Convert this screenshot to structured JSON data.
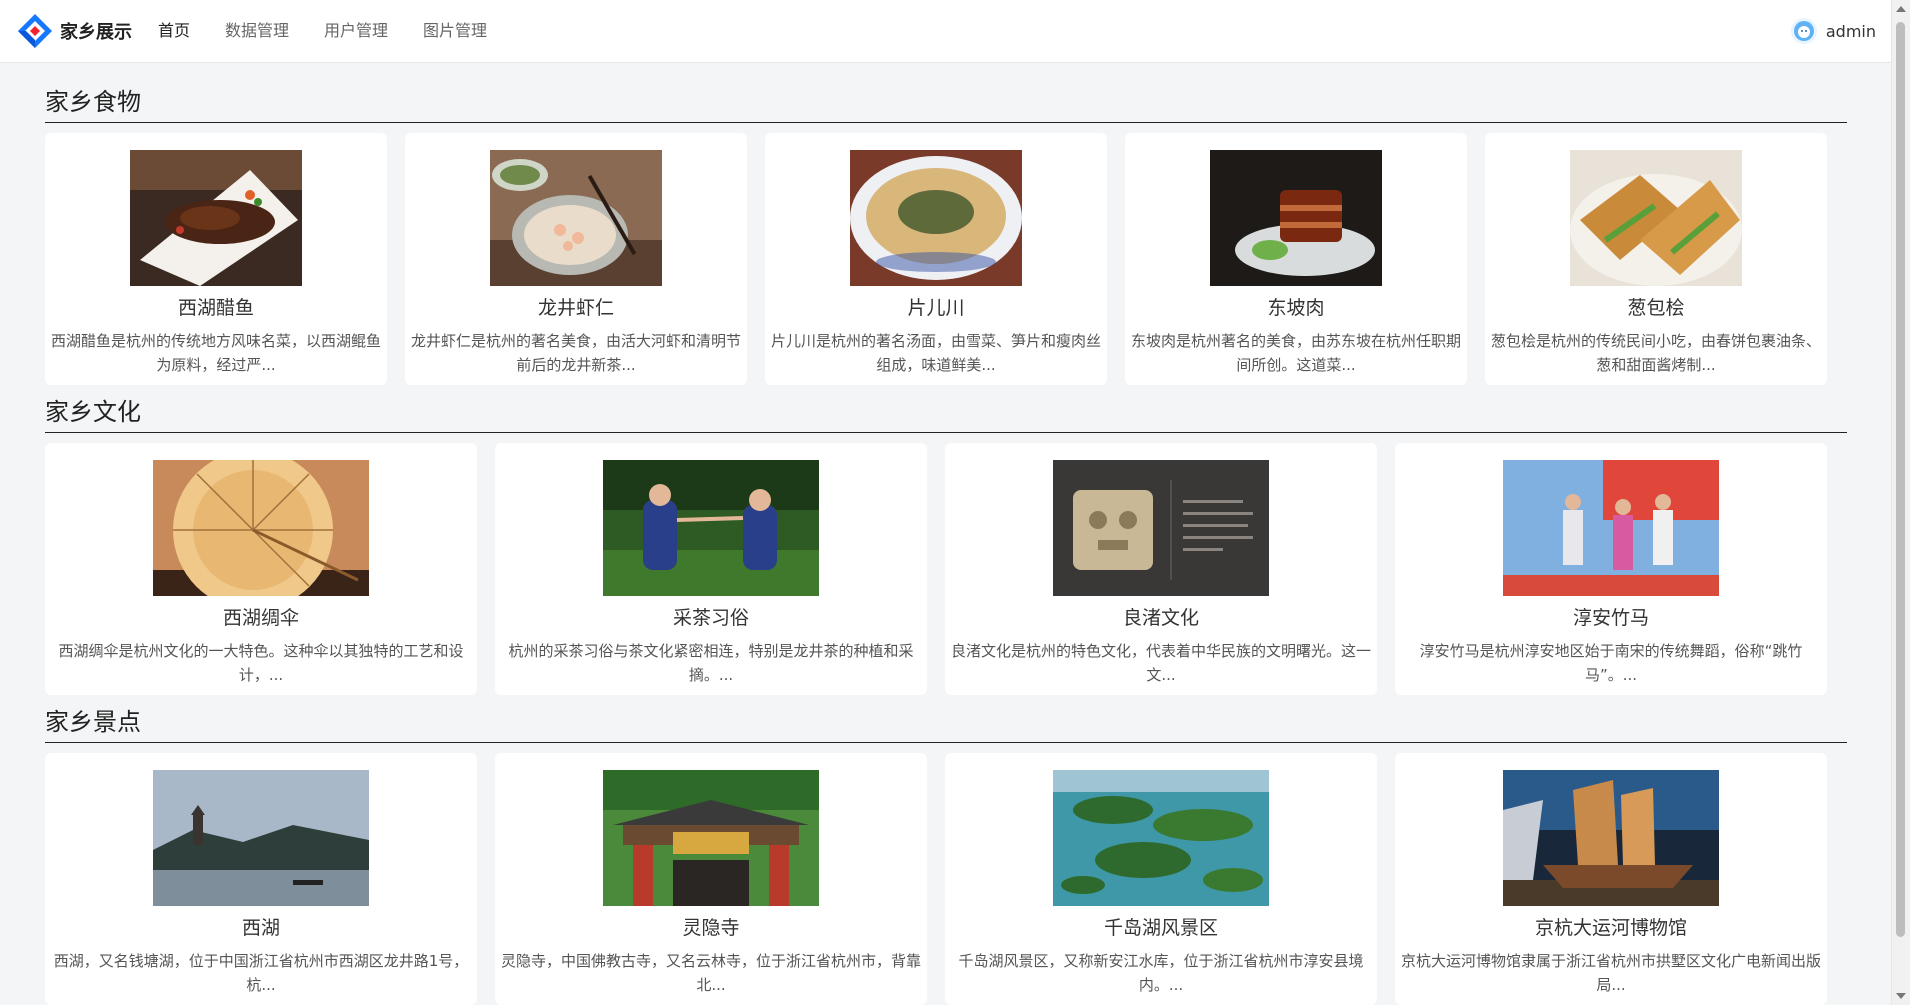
{
  "header": {
    "logo_text": "家乡展示",
    "nav": [
      "首页",
      "数据管理",
      "用户管理",
      "图片管理"
    ],
    "active_nav": "首页",
    "username": "admin"
  },
  "sections": [
    {
      "title": "家乡食物",
      "items": [
        {
          "name": "西湖醋鱼",
          "desc": "西湖醋鱼是杭州的传统地方风味名菜，以西湖鲲鱼为原料，经过严..."
        },
        {
          "name": "龙井虾仁",
          "desc": "龙井虾仁是杭州的著名美食，由活大河虾和清明节前后的龙井新茶..."
        },
        {
          "name": "片儿川",
          "desc": "片儿川是杭州的著名汤面，由雪菜、笋片和瘦肉丝组成，味道鲜美..."
        },
        {
          "name": "东坡肉",
          "desc": "东坡肉是杭州著名的美食，由苏东坡在杭州任职期间所创。这道菜..."
        },
        {
          "name": "葱包桧",
          "desc": "葱包桧是杭州的传统民间小吃，由春饼包裹油条、葱和甜面酱烤制..."
        }
      ]
    },
    {
      "title": "家乡文化",
      "items": [
        {
          "name": "西湖绸伞",
          "desc": "西湖绸伞是杭州文化的一大特色。这种伞以其独特的工艺和设计，..."
        },
        {
          "name": "采茶习俗",
          "desc": "杭州的采茶习俗与茶文化紧密相连，特别是龙井茶的种植和采摘。..."
        },
        {
          "name": "良渚文化",
          "desc": "良渚文化是杭州的特色文化，代表着中华民族的文明曙光。这一文..."
        },
        {
          "name": "淳安竹马",
          "desc": "淳安竹马是杭州淳安地区始于南宋的传统舞蹈，俗称“跳竹马”。..."
        }
      ]
    },
    {
      "title": "家乡景点",
      "items": [
        {
          "name": "西湖",
          "desc": "西湖，又名钱塘湖，位于中国浙江省杭州市西湖区龙井路1号，杭..."
        },
        {
          "name": "灵隐寺",
          "desc": "灵隐寺，中国佛教古寺，又名云林寺，位于浙江省杭州市，背靠北..."
        },
        {
          "name": "千岛湖风景区",
          "desc": "千岛湖风景区，又称新安江水库，位于浙江省杭州市淳安县境内。..."
        },
        {
          "name": "京杭大运河博物馆",
          "desc": "京杭大运河博物馆隶属于浙江省杭州市拱墅区文化广电新闻出版局..."
        }
      ]
    }
  ]
}
